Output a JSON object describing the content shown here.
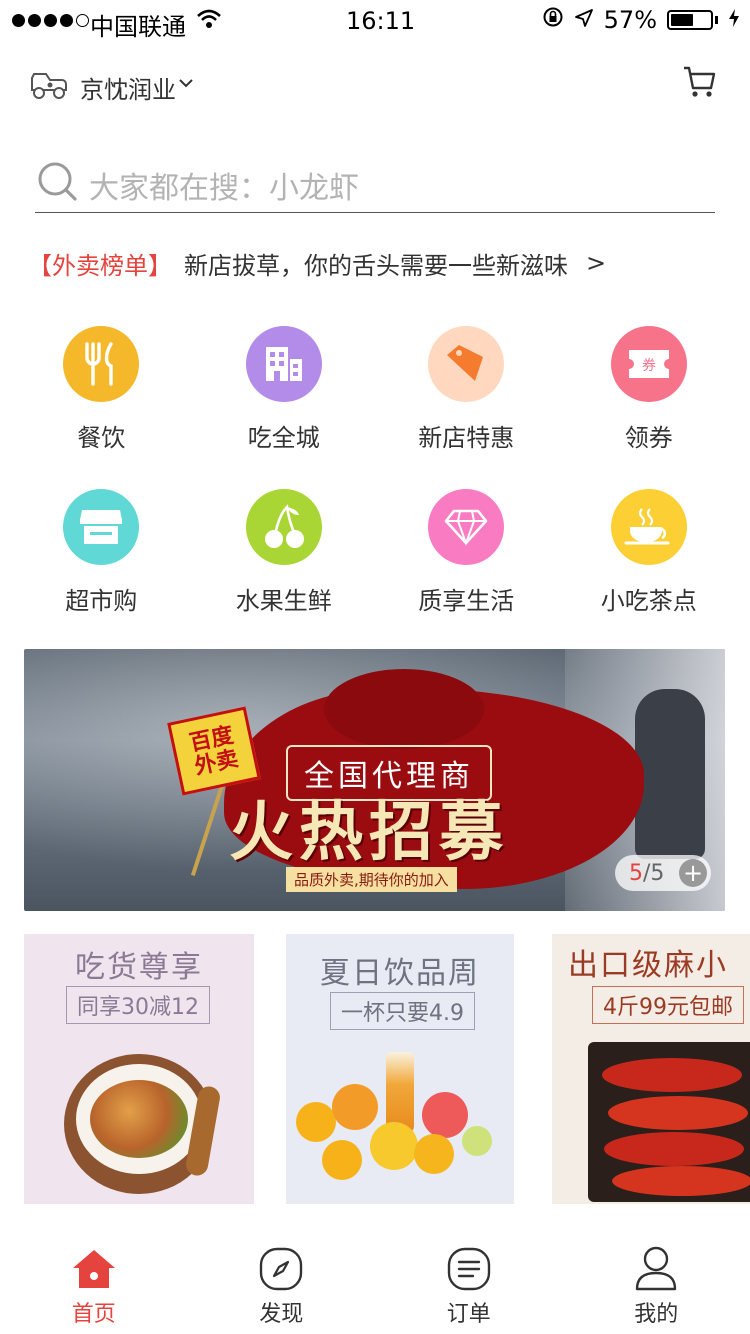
{
  "status_bar": {
    "carrier": "中国联通",
    "time": "16:11",
    "battery": "57%",
    "battery_level": 0.57
  },
  "header": {
    "location": "京忱润业"
  },
  "search": {
    "placeholder": "大家都在搜：小龙虾"
  },
  "notice": {
    "tag": "【外卖榜单】",
    "text": "新店拔草，你的舌头需要一些新滋味",
    "arrow": ">"
  },
  "categories": [
    {
      "label": "餐饮",
      "icon": "fork-knife-icon",
      "color": "#f5b82a"
    },
    {
      "label": "吃全城",
      "icon": "building-icon",
      "color": "#b38be8"
    },
    {
      "label": "新店特惠",
      "icon": "price-tag-icon",
      "color": "#ffd8bf"
    },
    {
      "label": "领券",
      "icon": "ticket-icon",
      "color": "#f7738a"
    },
    {
      "label": "超市购",
      "icon": "shop-icon",
      "color": "#5fd8d6"
    },
    {
      "label": "水果生鲜",
      "icon": "cherry-icon",
      "color": "#a9d634"
    },
    {
      "label": "质享生活",
      "icon": "diamond-icon",
      "color": "#f97cc3"
    },
    {
      "label": "小吃茶点",
      "icon": "tea-cup-icon",
      "color": "#fcd034"
    }
  ],
  "banner": {
    "flag": "百度\n外卖",
    "subtitle": "全国代理商",
    "title": "火热招募",
    "tagline": "品质外卖,期待你的加入",
    "pager_current": "5",
    "pager_sep": "/",
    "pager_total": "5",
    "pager_plus": "+"
  },
  "promos": [
    {
      "title": "吃货尊享",
      "subtitle": "同享30减12"
    },
    {
      "title": "夏日饮品周",
      "subtitle": "一杯只要4.9"
    },
    {
      "title": "出口级麻小",
      "subtitle": "4斤99元包邮"
    }
  ],
  "tabs": [
    {
      "label": "首页",
      "icon": "home-icon",
      "active": true
    },
    {
      "label": "发现",
      "icon": "compass-icon",
      "active": false
    },
    {
      "label": "订单",
      "icon": "order-list-icon",
      "active": false
    },
    {
      "label": "我的",
      "icon": "user-icon",
      "active": false
    }
  ],
  "colors": {
    "accent": "#e5433d"
  }
}
